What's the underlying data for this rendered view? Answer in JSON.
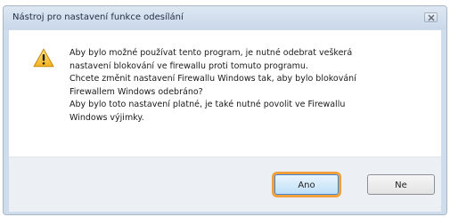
{
  "dialog": {
    "title": "Nástroj pro nastavení funkce odesílání",
    "close_icon": "close-icon",
    "warning_icon": "warning-icon",
    "message_lines": [
      "Aby bylo možné používat tento program, je nutné odebrat veškerá",
      "nastavení blokování ve firewallu proti tomuto programu.",
      "Chcete změnit nastavení Firewallu Windows tak, aby bylo blokování",
      "Firewallem Windows odebráno?",
      "Aby bylo toto nastavení platné, je také nutné povolit ve Firewallu",
      "Windows výjimky."
    ],
    "buttons": {
      "yes_label": "Ano",
      "no_label": "Ne"
    },
    "colors": {
      "highlight": "#f0a13b",
      "title_bar": "#cfdceb"
    }
  }
}
